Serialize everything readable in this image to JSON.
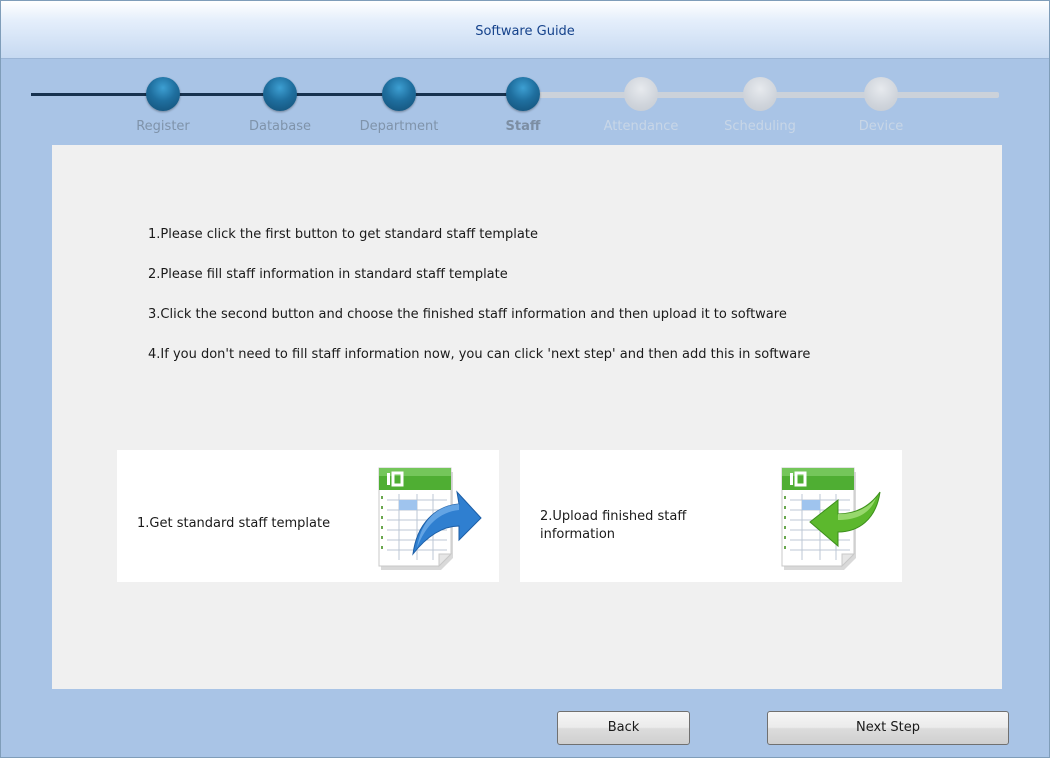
{
  "window": {
    "title": "Software Guide"
  },
  "steps": [
    {
      "label": "Register",
      "state": "done"
    },
    {
      "label": "Database",
      "state": "done"
    },
    {
      "label": "Department",
      "state": "done"
    },
    {
      "label": "Staff",
      "state": "current"
    },
    {
      "label": "Attendance",
      "state": "todo"
    },
    {
      "label": "Scheduling",
      "state": "todo"
    },
    {
      "label": "Device",
      "state": "todo"
    }
  ],
  "instructions": [
    "1.Please click the first button to get standard staff template",
    "2.Please fill staff information in standard staff template",
    "3.Click the second button and choose the finished staff information and then upload it to software",
    "4.If you don't need to fill staff information now, you can click 'next step' and then add this in software"
  ],
  "cards": {
    "get_template": {
      "label": "1.Get standard staff template",
      "icon": "spreadsheet-export-icon"
    },
    "upload": {
      "label_line1": "2.Upload finished staff",
      "label_line2": "information",
      "icon": "spreadsheet-import-icon"
    }
  },
  "buttons": {
    "back": "Back",
    "next": "Next Step"
  },
  "colors": {
    "window_bg": "#a9c4e6",
    "title_text": "#15428b",
    "step_done": "#1f6f9f",
    "step_todo": "#cfd4db",
    "arrow_export": "#2f7fd0",
    "arrow_import": "#5cb82d",
    "sheet_header": "#4fae33"
  }
}
